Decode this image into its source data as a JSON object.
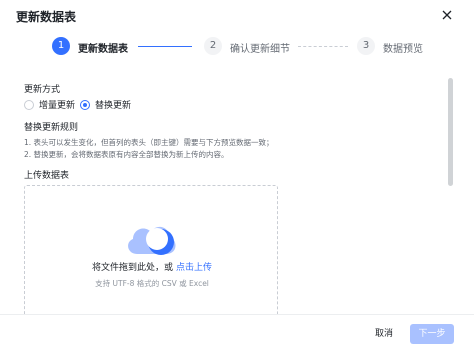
{
  "dialog": {
    "title": "更新数据表"
  },
  "steps": [
    {
      "number": "1",
      "label": "更新数据表",
      "state": "active"
    },
    {
      "number": "2",
      "label": "确认更新细节",
      "state": "pending"
    },
    {
      "number": "3",
      "label": "数据预览",
      "state": "pending"
    }
  ],
  "update_mode": {
    "label": "更新方式",
    "options": [
      {
        "label": "增量更新",
        "selected": false
      },
      {
        "label": "替换更新",
        "selected": true
      }
    ]
  },
  "rules": {
    "label": "替换更新规则",
    "items": [
      "1. 表头可以发生变化，但首列的表头（即主键）需要与下方预览数据一致；",
      "2. 替换更新，会将数据表原有内容全部替换为新上传的内容。"
    ]
  },
  "upload": {
    "label": "上传数据表",
    "text": "将文件拖到此处，或",
    "link": "点击上传",
    "hint": "支持 UTF-8 格式的 CSV 或 Excel",
    "icon": "cloud-upload-icon"
  },
  "footer": {
    "cancel_label": "取消",
    "next_label": "下一步"
  },
  "colors": {
    "accent": "#3370ff",
    "accent_disabled": "#a9c1ff",
    "text_primary": "#1f2329",
    "text_secondary": "#646a73"
  }
}
